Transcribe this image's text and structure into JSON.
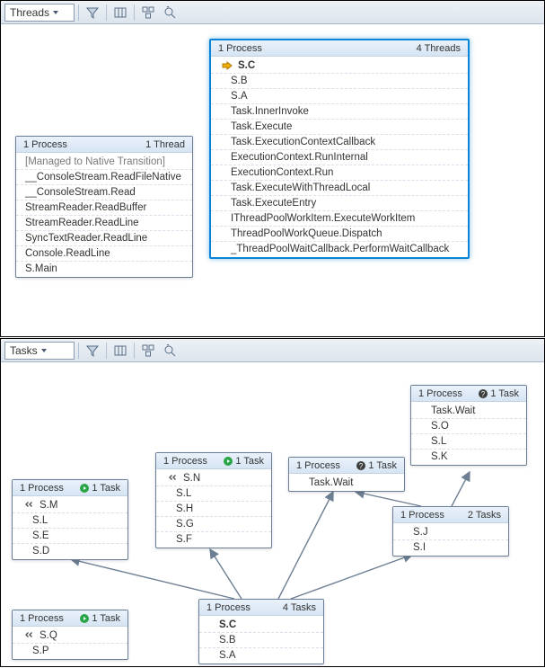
{
  "colors": {
    "selection": "#0a84d6",
    "panelBg": "#ffffff",
    "hdrGrad1": "#eaf2fb",
    "hdrGrad2": "#d6e4f3"
  },
  "threadsPane": {
    "combo": {
      "value": "Threads"
    },
    "box1": {
      "hdrLeft": "1 Process",
      "hdrRight": "1 Thread",
      "rows": [
        "[Managed to Native Transition]",
        "__ConsoleStream.ReadFileNative",
        "__ConsoleStream.Read",
        "StreamReader.ReadBuffer",
        "StreamReader.ReadLine",
        "SyncTextReader.ReadLine",
        "Console.ReadLine",
        "S.Main"
      ]
    },
    "box2": {
      "hdrLeft": "1 Process",
      "hdrRight": "4 Threads",
      "rows": [
        "S.C",
        "S.B",
        "S.A",
        "Task.InnerInvoke",
        "Task.Execute",
        "Task.ExecutionContextCallback",
        "ExecutionContext.RunInternal",
        "ExecutionContext.Run",
        "Task.ExecuteWithThreadLocal",
        "Task.ExecuteEntry",
        "IThreadPoolWorkItem.ExecuteWorkItem",
        "ThreadPoolWorkQueue.Dispatch",
        "_ThreadPoolWaitCallback.PerformWaitCallback"
      ]
    }
  },
  "tasksPane": {
    "combo": {
      "value": "Tasks"
    },
    "boxes": {
      "SM": {
        "hdrLeft": "1 Process",
        "hdrRight": "1 Task",
        "icon": "play",
        "rows": [
          "S.M",
          "S.L",
          "S.E",
          "S.D"
        ]
      },
      "SN": {
        "hdrLeft": "1 Process",
        "hdrRight": "1 Task",
        "icon": "play",
        "rows": [
          "S.N",
          "S.L",
          "S.H",
          "S.G",
          "S.F"
        ]
      },
      "TW1": {
        "hdrLeft": "1 Process",
        "hdrRight": "1 Task",
        "icon": "question",
        "rows": [
          "Task.Wait"
        ]
      },
      "TW2": {
        "hdrLeft": "1 Process",
        "hdrRight": "1 Task",
        "icon": "question",
        "rows": [
          "Task.Wait",
          "S.O",
          "S.L",
          "S.K"
        ]
      },
      "SJ": {
        "hdrLeft": "1 Process",
        "hdrRight": "2 Tasks",
        "icon": "",
        "rows": [
          "S.J",
          "S.I"
        ]
      },
      "SC": {
        "hdrLeft": "1 Process",
        "hdrRight": "4 Tasks",
        "icon": "",
        "rows": [
          "S.C",
          "S.B",
          "S.A"
        ]
      },
      "SQ": {
        "hdrLeft": "1 Process",
        "hdrRight": "1 Task",
        "icon": "play",
        "rows": [
          "S.Q",
          "S.P"
        ]
      }
    }
  }
}
